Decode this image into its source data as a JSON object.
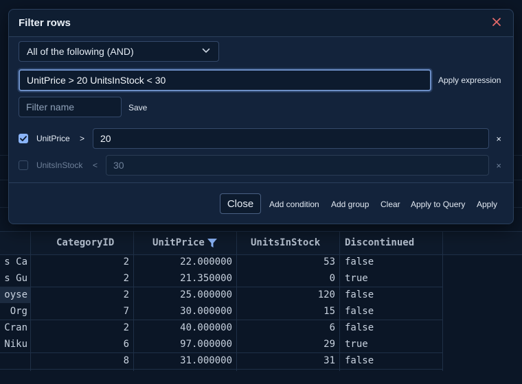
{
  "dialog": {
    "title": "Filter rows",
    "mode_selected": "All of the following (AND)",
    "expression_value": "UnitPrice > 20 UnitsInStock < 30",
    "apply_expression_label": "Apply expression",
    "filter_name_placeholder": "Filter name",
    "save_label": "Save",
    "conditions": [
      {
        "enabled": true,
        "field": "UnitPrice",
        "operator": ">",
        "value": "20"
      },
      {
        "enabled": false,
        "field": "UnitsInStock",
        "operator": "<",
        "value": "30"
      }
    ],
    "remove_label": "×",
    "footer": {
      "close_label": "Close",
      "add_condition_label": "Add condition",
      "add_group_label": "Add group",
      "clear_label": "Clear",
      "apply_to_query_label": "Apply to Query",
      "apply_label": "Apply"
    }
  },
  "grid": {
    "columns": [
      "CategoryID",
      "UnitPrice",
      "UnitsInStock",
      "Discontinued"
    ],
    "rows": [
      [
        "s Ca",
        "2",
        "22.000000",
        "53",
        "false"
      ],
      [
        "s Gu",
        "2",
        "21.350000",
        "0",
        "true"
      ],
      [
        "oyse",
        "2",
        "25.000000",
        "120",
        "false"
      ],
      [
        " Org",
        "7",
        "30.000000",
        "15",
        "false"
      ],
      [
        "Cran",
        "2",
        "40.000000",
        "6",
        "false"
      ],
      [
        "Niku",
        "6",
        "97.000000",
        "29",
        "true"
      ],
      [
        "",
        "8",
        "31.000000",
        "31",
        "false"
      ]
    ]
  },
  "colors": {
    "accent": "#8ab4f8",
    "close_icon": "#e46a6a",
    "background": "#0b1626",
    "dialog": "#13233b"
  }
}
